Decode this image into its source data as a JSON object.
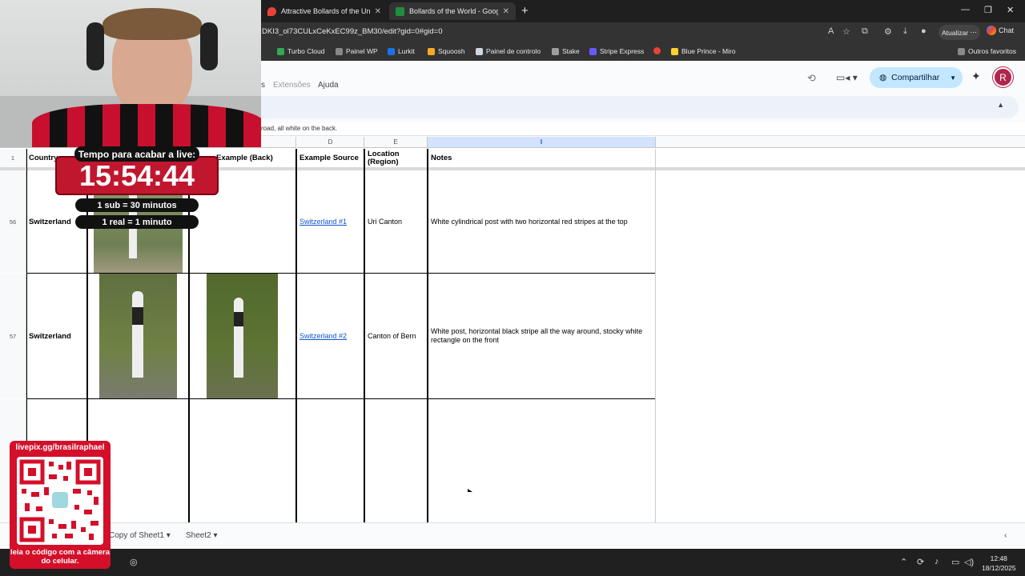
{
  "browser": {
    "tabs": [
      {
        "label": "Attractive Bollards of the Universe",
        "icon": "map-pin-icon",
        "color": "#ea4335"
      },
      {
        "label": "Bollards of the World - Google Sheets",
        "icon": "sheets-icon",
        "color": "#1e8e3e",
        "active": true
      }
    ],
    "url": "DKI3_ol73CULxCeKxEC99z_BM30/edit?gid=0#gid=0",
    "update_label": "Atualizar",
    "chat_label": "Chat",
    "bookmarks": [
      {
        "label": "Turbo Cloud",
        "color": "#34a853"
      },
      {
        "label": "Painel WP",
        "color": "#888888"
      },
      {
        "label": "Lurkit",
        "color": "#1a73e8"
      },
      {
        "label": "Squoosh",
        "color": "#f9a825"
      },
      {
        "label": "Painel de controlo",
        "color": "#cfd8dc"
      },
      {
        "label": "Stake",
        "color": "#9e9e9e"
      },
      {
        "label": "Stripe Express",
        "color": "#635bff"
      },
      {
        "label": "",
        "color": "#ea4335"
      },
      {
        "label": "Blue Prince - Miro",
        "color": "#ffd02f"
      }
    ],
    "other_bookmarks": "Outros favoritos"
  },
  "sheets": {
    "menu": [
      "s",
      "Extensões",
      "Ajuda"
    ],
    "share_label": "Compartilhar",
    "avatar_letter": "R",
    "formula_text": "road, all white on the back.",
    "columns": [
      {
        "letter": "D"
      },
      {
        "letter": "E"
      },
      {
        "letter": "I"
      }
    ],
    "header_row": {
      "num": "1",
      "country": "Country",
      "example_back": "Example (Back)",
      "example_source": "Example Source",
      "location": "Location (Region)",
      "notes": "Notes"
    },
    "rows": [
      {
        "num": "56",
        "country": "Switzerland",
        "source": "Switzerland #1",
        "location": "Uri Canton",
        "notes": "White cylindrical post with two horizontal red stripes at the top"
      },
      {
        "num": "57",
        "country": "Switzerland",
        "source": "Switzerland #2",
        "location": "Canton of Bern",
        "notes": "White post, horizontal black stripe all the way around, stocky white rectangle on the front"
      }
    ],
    "sheet_tabs": [
      "Copy of Sheet1",
      "Sheet2"
    ]
  },
  "taskbar": {
    "time": "12:48",
    "date": "18/12/2025"
  },
  "overlay": {
    "timer_title": "Tempo para acabar a live:",
    "timer_value": "15:54:44",
    "rule1": "1 sub = 30 minutos",
    "rule2": "1 real = 1 minuto",
    "qr_url": "livepix.gg/brasilraphael",
    "qr_caption": "leia o código com a câmera do celular."
  }
}
